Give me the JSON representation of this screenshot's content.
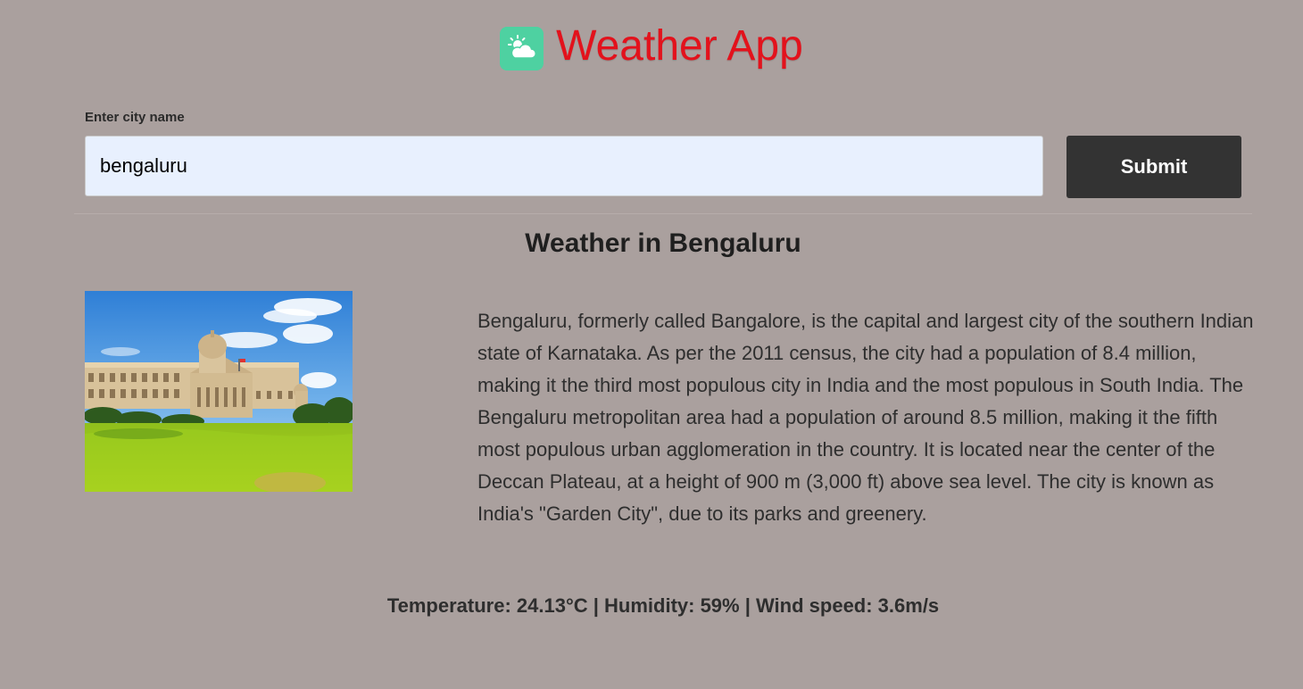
{
  "header": {
    "title": "Weather App",
    "logo_icon": "cloud-sun-icon",
    "logo_color": "#4ed1a1",
    "title_color": "#e3121c"
  },
  "search": {
    "label": "Enter city name",
    "value": "bengaluru",
    "placeholder": "",
    "submit_label": "Submit"
  },
  "result": {
    "heading": "Weather in Bengaluru",
    "image_alt": "Vidhana Soudha, Bengaluru",
    "description": "Bengaluru, formerly called Bangalore, is the capital and largest city of the southern Indian state of Karnataka. As per the 2011 census, the city had a population of 8.4 million, making it the third most populous city in India and the most populous in South India. The Bengaluru metropolitan area had a population of around 8.5 million, making it the fifth most populous urban agglomeration in the country. It is located near the center of the Deccan Plateau, at a height of 900 m (3,000 ft) above sea level. The city is known as India's \"Garden City\", due to its parks and greenery.",
    "stats_line": "Temperature: 24.13°C | Humidity: 59% | Wind speed: 3.6m/s"
  },
  "colors": {
    "background": "#aaa09e",
    "button": "#333333",
    "input_bg": "#e8f0fe"
  }
}
